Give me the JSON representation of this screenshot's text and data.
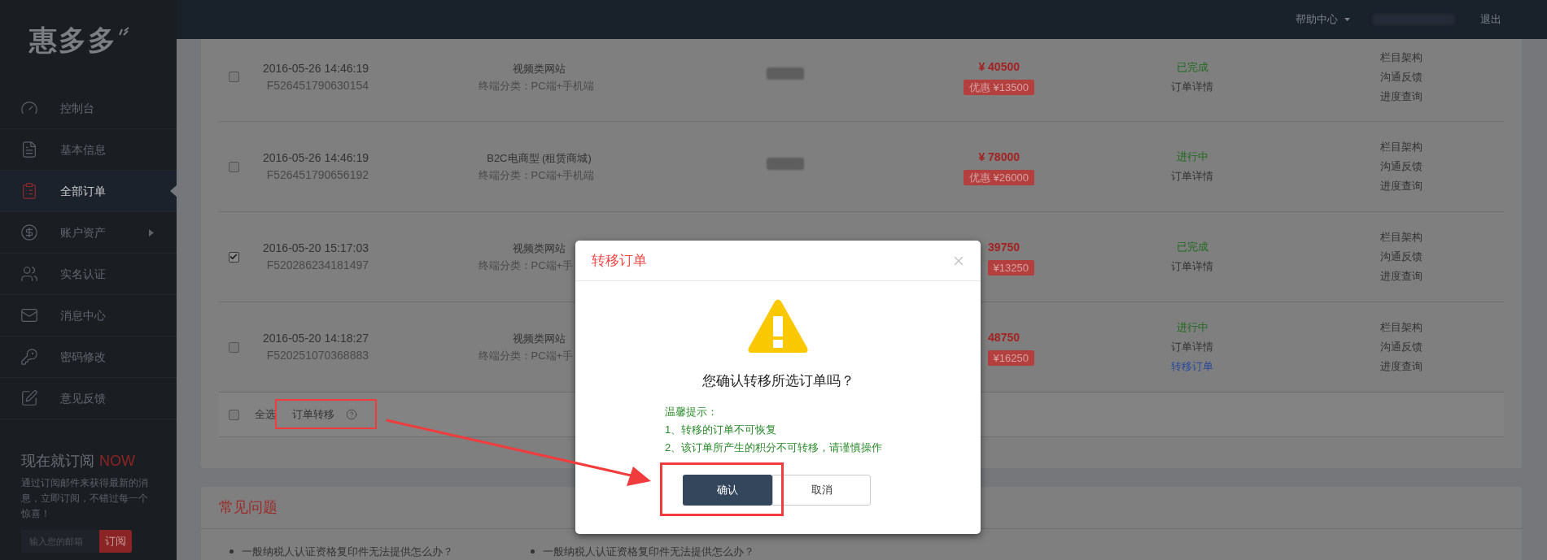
{
  "sidebar": {
    "logo": "惠多多",
    "items": [
      {
        "label": "控制台",
        "selected": false,
        "has_submenu": false
      },
      {
        "label": "基本信息",
        "selected": false,
        "has_submenu": false
      },
      {
        "label": "全部订单",
        "selected": true,
        "has_submenu": false
      },
      {
        "label": "账户资产",
        "selected": false,
        "has_submenu": true
      },
      {
        "label": "实名认证",
        "selected": false,
        "has_submenu": false
      },
      {
        "label": "消息中心",
        "selected": false,
        "has_submenu": false
      },
      {
        "label": "密码修改",
        "selected": false,
        "has_submenu": false
      },
      {
        "label": "意见反馈",
        "selected": false,
        "has_submenu": false
      }
    ],
    "subscribe": {
      "title": "现在就订阅",
      "accent": "NOW",
      "text": "通过订阅邮件来获得最新的消息，立即订阅，不错过每一个惊喜！",
      "placeholder": "输入您的邮箱",
      "button": "订阅"
    }
  },
  "topbar": {
    "help": "帮助中心",
    "logout": "退出"
  },
  "orders": {
    "rows": [
      {
        "checked": false,
        "masked_field": true,
        "date": "2016-05-26 14:46:19",
        "order_no": "F526451790630154",
        "product": "视频类网站",
        "terminal": "终端分类：PC端+手机端",
        "price": "¥ 40500",
        "discount": "优惠 ¥13500",
        "status": "已完成",
        "links": [
          {
            "label": "订单详情",
            "kind": "detail"
          }
        ],
        "actions": [
          "栏目架构",
          "沟通反馈",
          "进度查询"
        ]
      },
      {
        "checked": false,
        "masked_field": true,
        "date": "2016-05-26 14:46:19",
        "order_no": "F526451790656192",
        "product": "B2C电商型 (租赁商城)",
        "terminal": "终端分类：PC端+手机端",
        "price": "¥ 78000",
        "discount": "优惠 ¥26000",
        "status": "进行中",
        "links": [
          {
            "label": "订单详情",
            "kind": "detail"
          }
        ],
        "actions": [
          "栏目架构",
          "沟通反馈",
          "进度查询"
        ]
      },
      {
        "checked": true,
        "masked_field": false,
        "date": "2016-05-20 15:17:03",
        "order_no": "F520286234181497",
        "product": "视频类网站",
        "terminal": "终端分类：PC端+手",
        "price": "39750",
        "discount": "¥13250",
        "status": "已完成",
        "links": [
          {
            "label": "订单详情",
            "kind": "detail"
          }
        ],
        "actions": [
          "栏目架构",
          "沟通反馈",
          "进度查询"
        ]
      },
      {
        "checked": false,
        "masked_field": false,
        "date": "2016-05-20 14:18:27",
        "order_no": "F520251070368883",
        "product": "视频类网站",
        "terminal": "终端分类：PC端+手",
        "price": "48750",
        "discount": "¥16250",
        "status": "进行中",
        "links": [
          {
            "label": "订单详情",
            "kind": "detail"
          },
          {
            "label": "转移订单",
            "kind": "transfer"
          }
        ],
        "actions": [
          "栏目架构",
          "沟通反馈",
          "进度查询"
        ]
      }
    ],
    "footer": {
      "checked": false,
      "select_all": "全选",
      "transfer": "订单转移"
    }
  },
  "faq": {
    "title": "常见问题",
    "items": [
      "一般纳税人认证资格复印件无法提供怎么办？",
      "一般纳税人认证资格复印件无法提供怎么办？"
    ]
  },
  "dialog": {
    "title": "转移订单",
    "question": "您确认转移所选订单吗？",
    "tips_title": "温馨提示：",
    "tips": [
      "1、转移的订单不可恢复",
      "2、该订单所产生的积分不可转移，请谨慎操作"
    ],
    "confirm": "确认",
    "cancel": "取消"
  }
}
